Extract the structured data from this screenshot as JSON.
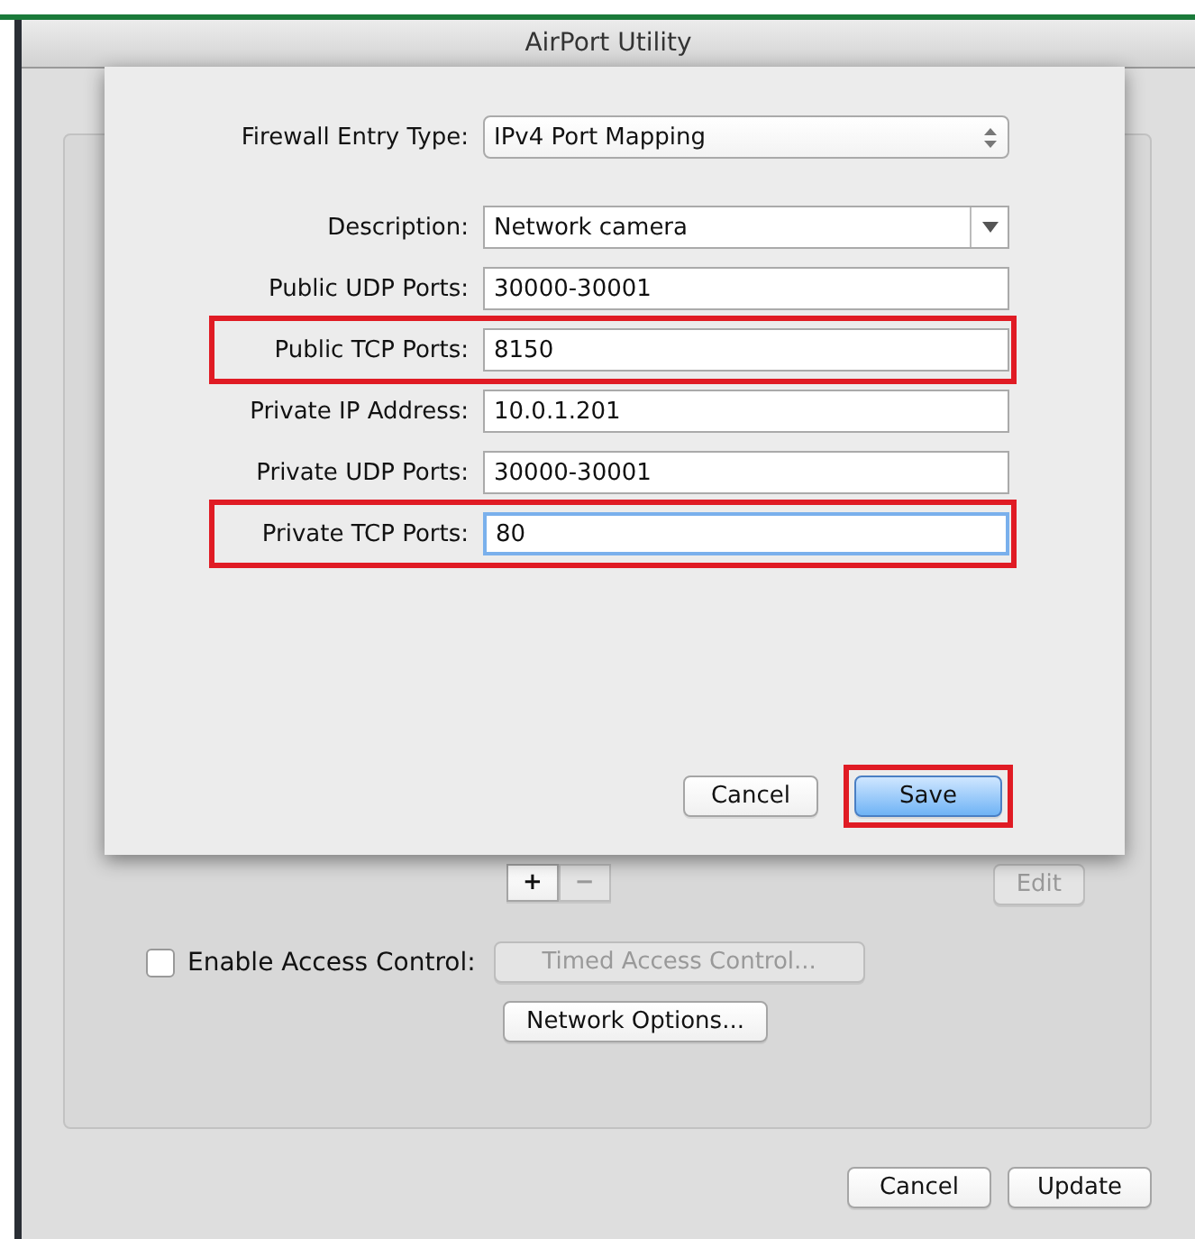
{
  "window": {
    "title": "AirPort Utility"
  },
  "sheet": {
    "fields": [
      {
        "label": "Firewall Entry Type:",
        "kind": "popup",
        "value": "IPv4 Port Mapping",
        "highlighted": false,
        "focused": false
      },
      {
        "label": "Description:",
        "kind": "combo",
        "value": "Network camera",
        "highlighted": false,
        "focused": false
      },
      {
        "label": "Public UDP Ports:",
        "kind": "text",
        "value": "30000-30001",
        "highlighted": false,
        "focused": false
      },
      {
        "label": "Public TCP Ports:",
        "kind": "text",
        "value": "8150",
        "highlighted": true,
        "focused": false
      },
      {
        "label": "Private IP Address:",
        "kind": "text",
        "value": "10.0.1.201",
        "highlighted": false,
        "focused": false
      },
      {
        "label": "Private UDP Ports:",
        "kind": "text",
        "value": "30000-30001",
        "highlighted": false,
        "focused": false
      },
      {
        "label": "Private TCP Ports:",
        "kind": "text",
        "value": "80",
        "highlighted": true,
        "focused": true
      }
    ],
    "buttons": [
      {
        "label": "Cancel",
        "default": false,
        "highlighted": false
      },
      {
        "label": "Save",
        "default": true,
        "highlighted": true
      }
    ]
  },
  "panel": {
    "add_remove": [
      {
        "label": "+",
        "disabled": false
      },
      {
        "label": "−",
        "disabled": true
      }
    ],
    "edit_button": {
      "label": "Edit",
      "disabled": true
    },
    "access_control": {
      "label": "Enable Access Control:",
      "checked": false
    },
    "timed_button": {
      "label": "Timed Access Control...",
      "disabled": true
    },
    "options_button": {
      "label": "Network Options...",
      "disabled": false
    }
  },
  "footer_buttons": [
    {
      "label": "Cancel"
    },
    {
      "label": "Update"
    }
  ]
}
